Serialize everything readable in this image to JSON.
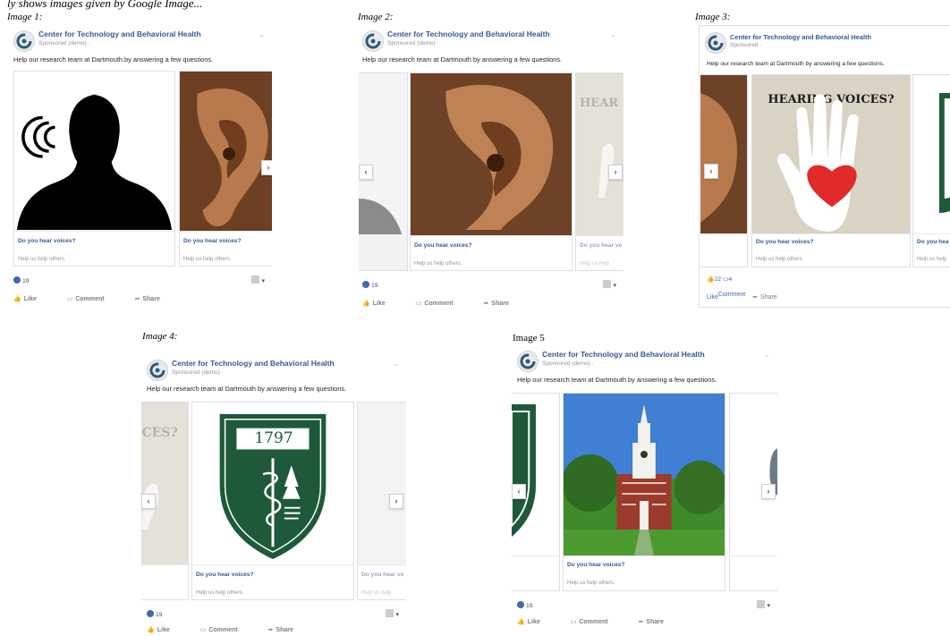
{
  "caption": "ly shows images given by Google Image...",
  "post": {
    "page_name": "Center for Technology and Behavioral Health",
    "sponsored": "Sponsored (demo) ·",
    "sponsored_alt": "Sponsored ·",
    "body": "Help our research team at Dartmouth by answering a few questions.",
    "card_title": "Do you hear voices?",
    "card_sub": "Help us help others.",
    "hearing_text": "HEARING VOICES?",
    "hear_partial": "HEAR",
    "ices_partial": "ICES?",
    "do_you_hear_partial": "Do you hear ve",
    "do_you_hea_partial": "Do you hea",
    "help_partial": "Help us help",
    "help_partial2": "Help us help ot",
    "seal_year": "1797",
    "actions": {
      "like": "Like",
      "comment": "Comment",
      "share": "Share"
    }
  },
  "screens": [
    {
      "label": "Image 1:",
      "reactions": "19"
    },
    {
      "label": "Image 2:",
      "reactions": "19"
    },
    {
      "label": "Image 3:",
      "likes": "22",
      "comments": "4"
    },
    {
      "label": "Image 4:",
      "reactions": "19"
    },
    {
      "label": "Image 5",
      "reactions": "19"
    }
  ],
  "colors": {
    "link": "#365899",
    "fb_blue": "#4267b2",
    "shield_green": "#1e5a3a",
    "sky": "#3f7fd4"
  }
}
